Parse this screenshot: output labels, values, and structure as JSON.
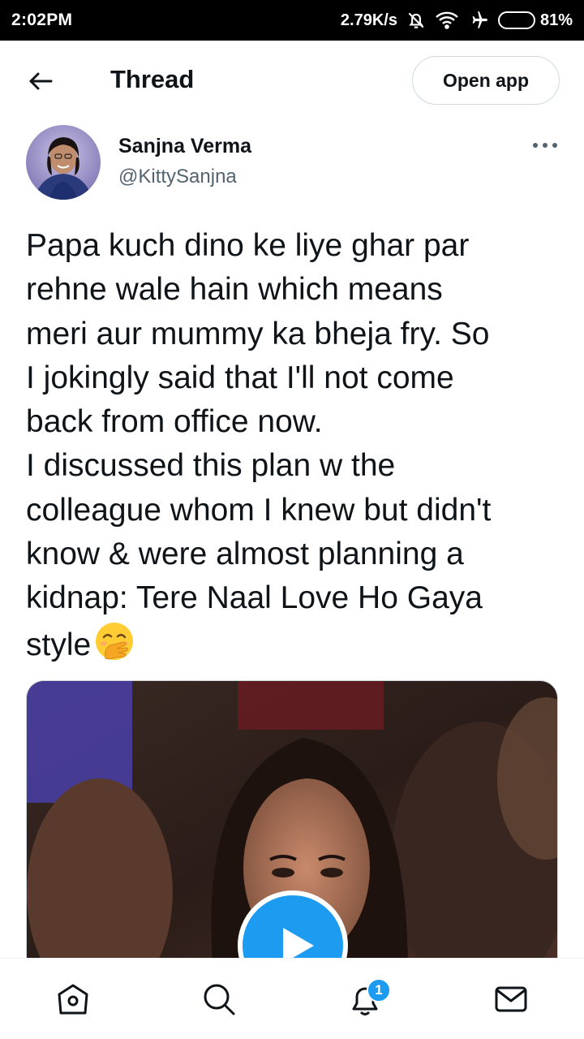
{
  "status_bar": {
    "time": "2:02PM",
    "network_speed": "2.79K/s",
    "battery_percent": "81%",
    "battery_level": 0.81,
    "icons": [
      "mute-bell-icon",
      "wifi-icon",
      "airplane-icon",
      "battery-icon"
    ]
  },
  "header": {
    "back_icon": "back-arrow-icon",
    "title": "Thread",
    "open_app_label": "Open app"
  },
  "tweet": {
    "author_name": "Sanjna Verma",
    "author_handle": "@KittySanjna",
    "more_icon": "more-dots-icon",
    "text": "Papa kuch dino ke liye ghar par\nrehne wale hain which means\nmeri aur mummy ka bheja fry. So\nI jokingly said that I'll not come\nback from office now.\nI discussed this plan w the\ncolleague whom I knew but didn't\nknow & were almost planning a\nkidnap: Tere Naal Love Ho Gaya\nstyle",
    "emoji": "face-with-hand-over-mouth",
    "media": {
      "type": "video",
      "play_icon": "play-icon"
    }
  },
  "bottom_nav": {
    "items": [
      {
        "name": "home",
        "icon": "home-icon"
      },
      {
        "name": "search",
        "icon": "search-icon"
      },
      {
        "name": "notifications",
        "icon": "bell-icon",
        "badge": "1"
      },
      {
        "name": "messages",
        "icon": "mail-icon"
      }
    ]
  },
  "colors": {
    "accent": "#1d9bf0",
    "text_primary": "#0f1419",
    "text_secondary": "#536471",
    "border": "#cfd9de"
  }
}
